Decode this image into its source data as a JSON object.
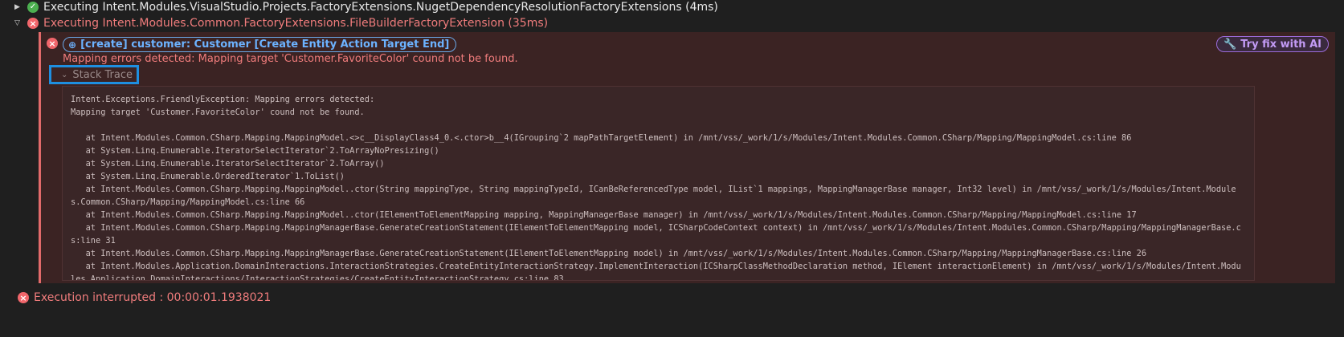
{
  "log": {
    "entry1": {
      "status": "success",
      "text": "Executing Intent.Modules.VisualStudio.Projects.FactoryExtensions.NugetDependencyResolutionFactoryExtensions (4ms)"
    },
    "entry2": {
      "status": "error",
      "text": "Executing Intent.Modules.Common.FactoryExtensions.FileBuilderFactoryExtension (35ms)"
    },
    "error": {
      "target_chip": "[create] customer: Customer [Create Entity Action Target End]",
      "ai_button": "Try fix with AI",
      "message": "Mapping errors detected: Mapping target 'Customer.FavoriteColor' cound not be found.",
      "stack_toggle": "Stack Trace",
      "stack_trace": "Intent.Exceptions.FriendlyException: Mapping errors detected:\nMapping target 'Customer.FavoriteColor' cound not be found.\n\n   at Intent.Modules.Common.CSharp.Mapping.MappingModel.<>c__DisplayClass4_0.<.ctor>b__4(IGrouping`2 mapPathTargetElement) in /mnt/vss/_work/1/s/Modules/Intent.Modules.Common.CSharp/Mapping/MappingModel.cs:line 86\n   at System.Linq.Enumerable.IteratorSelectIterator`2.ToArrayNoPresizing()\n   at System.Linq.Enumerable.IteratorSelectIterator`2.ToArray()\n   at System.Linq.Enumerable.OrderedIterator`1.ToList()\n   at Intent.Modules.Common.CSharp.Mapping.MappingModel..ctor(String mappingType, String mappingTypeId, ICanBeReferencedType model, IList`1 mappings, MappingManagerBase manager, Int32 level) in /mnt/vss/_work/1/s/Modules/Intent.Modules.Common.CSharp/Mapping/MappingModel.cs:line 66\n   at Intent.Modules.Common.CSharp.Mapping.MappingModel..ctor(IElementToElementMapping mapping, MappingManagerBase manager) in /mnt/vss/_work/1/s/Modules/Intent.Modules.Common.CSharp/Mapping/MappingModel.cs:line 17\n   at Intent.Modules.Common.CSharp.Mapping.MappingManagerBase.GenerateCreationStatement(IElementToElementMapping model, ICSharpCodeContext context) in /mnt/vss/_work/1/s/Modules/Intent.Modules.Common.CSharp/Mapping/MappingManagerBase.cs:line 31\n   at Intent.Modules.Common.CSharp.Mapping.MappingManagerBase.GenerateCreationStatement(IElementToElementMapping model) in /mnt/vss/_work/1/s/Modules/Intent.Modules.Common.CSharp/Mapping/MappingManagerBase.cs:line 26\n   at Intent.Modules.Application.DomainInteractions.InteractionStrategies.CreateEntityInteractionStrategy.ImplementInteraction(ICSharpClassMethodDeclaration method, IElement interactionElement) in /mnt/vss/_work/1/s/Modules/Intent.Modules.Application.DomainInteractions/InteractionStrategies/CreateEntityInteractionStrategy.cs:line 83"
    },
    "interrupted": "Execution interrupted : 00:00:01.1938021"
  },
  "icons": {
    "expand": "caret-right-icon",
    "collapse": "caret-down-icon",
    "success": "check-circle-icon",
    "error": "x-circle-icon",
    "target": "crosshair-icon",
    "ai": "wrench-icon"
  },
  "colors": {
    "background": "#1f1f1f",
    "error_panel": "#3b2323",
    "error_text": "#f07c7c",
    "success": "#4caf50",
    "link": "#6cb2ff",
    "ai": "#c39bf5",
    "highlight": "#1e8fe0"
  }
}
